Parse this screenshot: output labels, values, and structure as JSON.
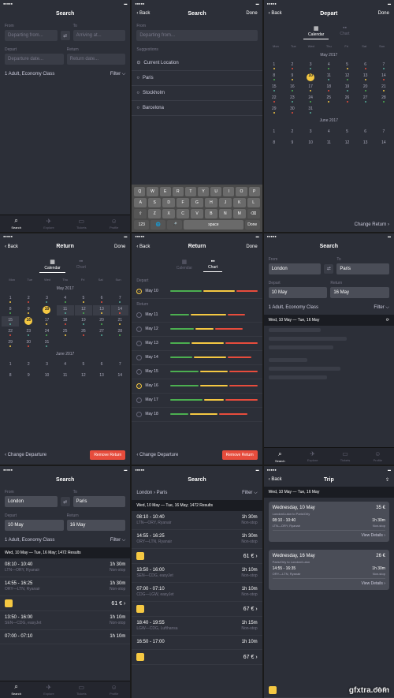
{
  "watermark": "gfxtra.com",
  "shared": {
    "days": [
      "Mon",
      "Tue",
      "Wed",
      "Thu",
      "Fri",
      "Sat",
      "Sun"
    ],
    "month1": "May 2017",
    "month2": "June 2017",
    "tabs": {
      "search": "Search",
      "explore": "Explore",
      "tickets": "Tickets",
      "profile": "Profile"
    },
    "seg": {
      "calendar": "Calendar",
      "chart": "Chart"
    }
  },
  "s1": {
    "title": "Search",
    "from_label": "From",
    "to_label": "To",
    "from_ph": "Departing from...",
    "to_ph": "Arriving at...",
    "depart_label": "Depart",
    "return_label": "Return",
    "depart_ph": "Departure date...",
    "return_ph": "Return date...",
    "pax": "1 Adult, Economy Class",
    "filter": "Filter ⌵"
  },
  "s2": {
    "back": "‹ Back",
    "title": "Search",
    "done": "Done",
    "from_label": "From",
    "from_ph": "Departing from...",
    "sug_h": "Suggestions",
    "sug": [
      "Current Location",
      "Paris",
      "Stockholm",
      "Barcelona"
    ],
    "keys1": [
      "Q",
      "W",
      "E",
      "R",
      "T",
      "Y",
      "U",
      "I",
      "O",
      "P"
    ],
    "keys2": [
      "A",
      "S",
      "D",
      "F",
      "G",
      "H",
      "J",
      "K",
      "L"
    ],
    "keys3": [
      "Z",
      "X",
      "C",
      "V",
      "B",
      "N",
      "M"
    ],
    "k123": "123",
    "kspace": "space",
    "kdone": "Done"
  },
  "s3": {
    "back": "‹ Back",
    "title": "Depart",
    "done": "Done",
    "selected_day": 10,
    "action": "Change Return ›"
  },
  "s4": {
    "back": "‹ Back",
    "title": "Return",
    "done": "Done",
    "sel": [
      10,
      16
    ],
    "range": [
      11,
      12,
      13,
      14,
      15
    ],
    "action_l": "‹ Change Departure",
    "action_r": "Remove Return"
  },
  "s5": {
    "back": "‹ Back",
    "title": "Return",
    "done": "Done",
    "depart_h": "Depart",
    "return_h": "Return",
    "rows": [
      {
        "label": "May 10",
        "sel": true
      },
      {
        "label": "May 11",
        "sel": false
      },
      {
        "label": "May 12",
        "sel": false
      },
      {
        "label": "May 13",
        "sel": false
      },
      {
        "label": "May 14",
        "sel": false
      },
      {
        "label": "May 15",
        "sel": false
      },
      {
        "label": "May 16",
        "sel": true
      },
      {
        "label": "May 17",
        "sel": false
      },
      {
        "label": "May 18",
        "sel": false
      }
    ],
    "action_l": "‹ Change Departure",
    "action_r": "Remove Return"
  },
  "s6": {
    "title": "Search",
    "from_label": "From",
    "to_label": "To",
    "from_val": "London",
    "to_val": "Paris",
    "depart_label": "Depart",
    "return_label": "Return",
    "depart_val": "10 May",
    "return_val": "16 May",
    "pax": "1 Adult, Economy Class",
    "filter": "Filter ⌵",
    "dates": "Wed, 10 May — Tue, 16 May"
  },
  "s7": {
    "title": "Search",
    "from_label": "From",
    "to_label": "To",
    "from_val": "London",
    "to_val": "Paris",
    "depart_label": "Depart",
    "return_label": "Return",
    "depart_val": "10 May",
    "return_val": "16 May",
    "pax": "1 Adult, Economy Class",
    "filter": "Filter ⌵",
    "bar": "Wed, 10 May — Tue, 16 May; 1472 Results",
    "r": [
      {
        "time": "08:10 - 10:40",
        "dur": "1h 30m",
        "route": "LTN—ORY, Ryanair",
        "stop": "Non-stop"
      },
      {
        "time": "14:55 - 16:25",
        "dur": "1h 30m",
        "route": "ORY—LTN, Ryanair",
        "stop": "Non-stop"
      }
    ],
    "price1": "61 € ›",
    "r2": [
      {
        "time": "13:50 - 16:00",
        "dur": "1h 10m",
        "route": "SEN—CDG, easyJet",
        "stop": "Non-stop"
      },
      {
        "time": "07:00 - 07:10",
        "dur": "1h 10m",
        "route": "",
        "stop": ""
      }
    ]
  },
  "s8": {
    "title": "Search",
    "crumb": "London › Paris",
    "filter": "Filter ⌵",
    "bar": "Wed, 10 May — Tue, 16 May; 1472 Results",
    "r": [
      {
        "time": "08:10 - 10:40",
        "dur": "1h 30m",
        "route": "LTN—ORY, Ryanair",
        "stop": "Non-stop"
      },
      {
        "time": "14:55 - 16:25",
        "dur": "1h 30m",
        "route": "ORY—LTN, Ryanair",
        "stop": "Non-stop",
        "price": "61 € ›"
      },
      {
        "time": "13:50 - 16:00",
        "dur": "1h 10m",
        "route": "SEN—CDG, easyJet",
        "stop": "Non-stop"
      },
      {
        "time": "07:00 - 07:10",
        "dur": "1h 10m",
        "route": "CDG—LGW, easyJet",
        "stop": "Non-stop",
        "price": "67 € ›"
      },
      {
        "time": "18:40 - 19:55",
        "dur": "1h 15m",
        "route": "LGW—CDG, Lufthansa",
        "stop": "Non-stop"
      },
      {
        "time": "16:50 - 17:00",
        "dur": "1h 10m",
        "route": "",
        "stop": "",
        "price": "67 € ›"
      }
    ]
  },
  "s9": {
    "back": "‹ Back",
    "title": "Trip",
    "bar": "Wed, 10 May — Tue, 16 May",
    "card1": {
      "date": "Wednesday, 10 May",
      "price": "35 €",
      "sub": "London/Luton to Paris/Orly",
      "time": "08:10 - 10:40",
      "dur": "1h 30m",
      "route": "LTN—ORY, Ryanair",
      "stop": "Non-stop",
      "detail": "View Details ›"
    },
    "card2": {
      "date": "Wednesday, 16 May",
      "price": "26 €",
      "sub": "Paris/Orly to London/Luton",
      "time": "14:55 - 16:35",
      "dur": "1h 30m",
      "route": "ORY—LTN, Ryanair",
      "stop": "Non-stop",
      "detail": "View Details ›"
    },
    "total": "61 € ›"
  }
}
